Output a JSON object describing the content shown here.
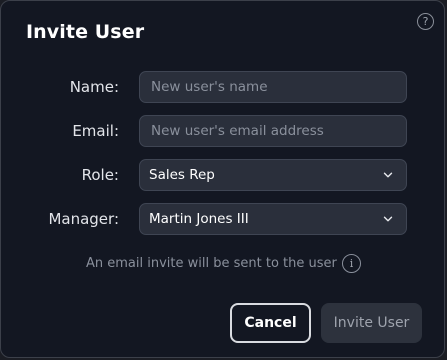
{
  "dialog": {
    "title": "Invite User",
    "help_icon": "question-circle-icon"
  },
  "form": {
    "name": {
      "label": "Name:",
      "value": "",
      "placeholder": "New user's name"
    },
    "email": {
      "label": "Email:",
      "value": "",
      "placeholder": "New user's email address"
    },
    "role": {
      "label": "Role:",
      "selected": "Sales Rep"
    },
    "manager": {
      "label": "Manager:",
      "selected": "Martin Jones III"
    }
  },
  "hint": {
    "text": "An email invite will be sent to the user",
    "icon": "info-icon"
  },
  "actions": {
    "cancel_label": "Cancel",
    "invite_label": "Invite User"
  }
}
